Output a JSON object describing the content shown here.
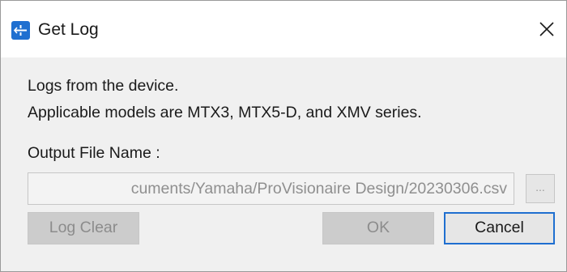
{
  "window": {
    "title": "Get Log",
    "icon": "app-icon",
    "close_icon": "close-icon"
  },
  "content": {
    "line1": "Logs from the device.",
    "line2": "Applicable models are MTX3, MTX5-D, and XMV series.",
    "output_label": "Output File Name :",
    "output_path": "cuments/Yamaha/ProVisionaire Design/20230306.csv",
    "browse_label": "..."
  },
  "buttons": {
    "log_clear": "Log Clear",
    "ok": "OK",
    "cancel": "Cancel"
  },
  "colors": {
    "accent": "#1f6fd0",
    "dialog_bg": "#f0f0f0",
    "disabled_text": "#8c8c8c"
  }
}
